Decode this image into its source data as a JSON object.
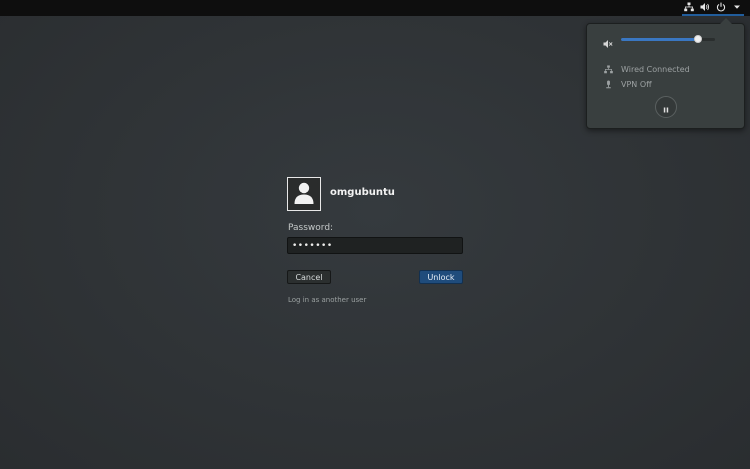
{
  "topbar": {
    "icons": [
      "network-wired-icon",
      "volume-icon",
      "power-icon",
      "arrow-down-icon"
    ]
  },
  "system_menu": {
    "volume": {
      "icon": "volume-muted-icon",
      "level": 0.82
    },
    "items": [
      {
        "icon": "network-wired-icon",
        "label": "Wired Connected"
      },
      {
        "icon": "vpn-icon",
        "label": "VPN Off"
      }
    ],
    "lock_button_icon": "pause-lock-icon"
  },
  "login": {
    "avatar_icon": "user-avatar-icon",
    "username": "omgubuntu",
    "password_label": "Password:",
    "password_value": "•••••••",
    "cancel_label": "Cancel",
    "unlock_label": "Unlock",
    "other_user_label": "Log in as another user"
  },
  "colors": {
    "accent": "#215d9c",
    "unlock_button": "#1f4c7c",
    "background": "#2f3336"
  }
}
